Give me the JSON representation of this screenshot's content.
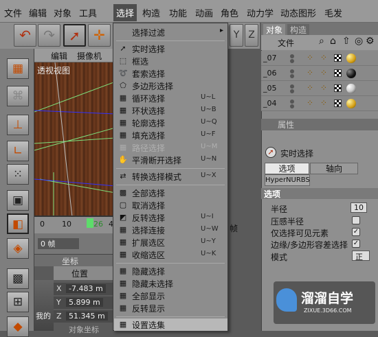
{
  "menubar": {
    "items": [
      "文件",
      "编辑",
      "对象",
      "工具",
      "选择",
      "构造",
      "功能",
      "动画",
      "角色",
      "动力学",
      "动态图形",
      "毛发"
    ],
    "active": "选择"
  },
  "toolbar": {
    "icons": [
      "undo-icon",
      "redo-icon",
      "select-arrow-icon",
      "move-icon"
    ]
  },
  "viewport": {
    "menu": [
      "编辑",
      "摄像机"
    ],
    "label": "透视视图"
  },
  "timeline": {
    "ticks": [
      "0",
      "10",
      "26",
      "4"
    ],
    "current_frame": "26",
    "frame_field": "0 帧",
    "frame_field_right": "帧"
  },
  "coordinates": {
    "section_label": "坐标",
    "position_label": "位置",
    "x_axis": "X",
    "x_value": "-7.483 m",
    "y_axis": "Y",
    "y_value": "5.899 m",
    "z_axis": "Z",
    "z_value": "51.345 m",
    "material_label": "我的",
    "bottom_label": "对象坐标"
  },
  "dropdown": {
    "items": [
      {
        "label": "选择过滤",
        "shortcut": "",
        "arrow": "▸",
        "icon": "",
        "disabled": false
      },
      {
        "label": "实时选择",
        "shortcut": "",
        "icon": "live-select-icon",
        "disabled": false
      },
      {
        "label": "框选",
        "shortcut": "",
        "icon": "rect-select-icon",
        "disabled": false
      },
      {
        "label": "套索选择",
        "shortcut": "",
        "icon": "lasso-select-icon",
        "disabled": false
      },
      {
        "label": "多边形选择",
        "shortcut": "",
        "icon": "polygon-select-icon",
        "disabled": false
      },
      {
        "label": "循环选择",
        "shortcut": "U~L",
        "icon": "loop-select-icon",
        "disabled": false
      },
      {
        "label": "环状选择",
        "shortcut": "U~B",
        "icon": "ring-select-icon",
        "disabled": false
      },
      {
        "label": "轮廓选择",
        "shortcut": "U~Q",
        "icon": "outline-select-icon",
        "disabled": false
      },
      {
        "label": "填充选择",
        "shortcut": "U~F",
        "icon": "fill-select-icon",
        "disabled": false
      },
      {
        "label": "路径选择",
        "shortcut": "U~M",
        "icon": "path-select-icon",
        "disabled": true
      },
      {
        "label": "平滑断开选择",
        "shortcut": "U~N",
        "icon": "phong-break-select-icon",
        "disabled": false
      },
      {
        "label": "转换选择模式",
        "shortcut": "U~X",
        "icon": "convert-selection-icon",
        "disabled": false
      },
      {
        "label": "全部选择",
        "shortcut": "",
        "icon": "select-all-icon",
        "disabled": false
      },
      {
        "label": "取消选择",
        "shortcut": "",
        "icon": "deselect-icon",
        "disabled": false
      },
      {
        "label": "反转选择",
        "shortcut": "U~I",
        "icon": "invert-select-icon",
        "disabled": false
      },
      {
        "label": "选择连接",
        "shortcut": "U~W",
        "icon": "select-connected-icon",
        "disabled": false
      },
      {
        "label": "扩展选区",
        "shortcut": "U~Y",
        "icon": "grow-selection-icon",
        "disabled": false
      },
      {
        "label": "收缩选区",
        "shortcut": "U~K",
        "icon": "shrink-selection-icon",
        "disabled": false
      },
      {
        "label": "隐藏选择",
        "shortcut": "",
        "icon": "hide-selected-icon",
        "disabled": false
      },
      {
        "label": "隐藏未选择",
        "shortcut": "",
        "icon": "hide-unselected-icon",
        "disabled": false
      },
      {
        "label": "全部显示",
        "shortcut": "",
        "icon": "unhide-all-icon",
        "disabled": false
      },
      {
        "label": "反转显示",
        "shortcut": "",
        "icon": "invert-visibility-icon",
        "disabled": false
      },
      {
        "label": "设置选集",
        "shortcut": "",
        "icon": "set-selection-icon",
        "disabled": false
      }
    ]
  },
  "objects_panel": {
    "tabs": [
      "对象",
      "构造"
    ],
    "menu": "文件",
    "rows": [
      {
        "name": "_07",
        "ball": "#d4a017"
      },
      {
        "name": "_06",
        "ball": "#111111"
      },
      {
        "name": "_05",
        "ball": "#c8c8c8"
      },
      {
        "name": "_04",
        "ball": "#d4a017"
      }
    ]
  },
  "attributes": {
    "header": "属性",
    "tool_name": "实时选择",
    "tabs": [
      "选项",
      "轴向"
    ],
    "sub_tab": "HyperNURBS",
    "section": "选项",
    "props": [
      {
        "label": "半径",
        "value": "10"
      },
      {
        "label": "压感半径",
        "checked": false
      },
      {
        "label": "仅选择可见元素",
        "checked": true
      },
      {
        "label": "边缘/多边形容差选择",
        "checked": true
      },
      {
        "label": "模式",
        "value": "正"
      }
    ]
  },
  "watermark": {
    "title": "溜溜自学",
    "url": "ZIXUE.3D66.COM"
  }
}
